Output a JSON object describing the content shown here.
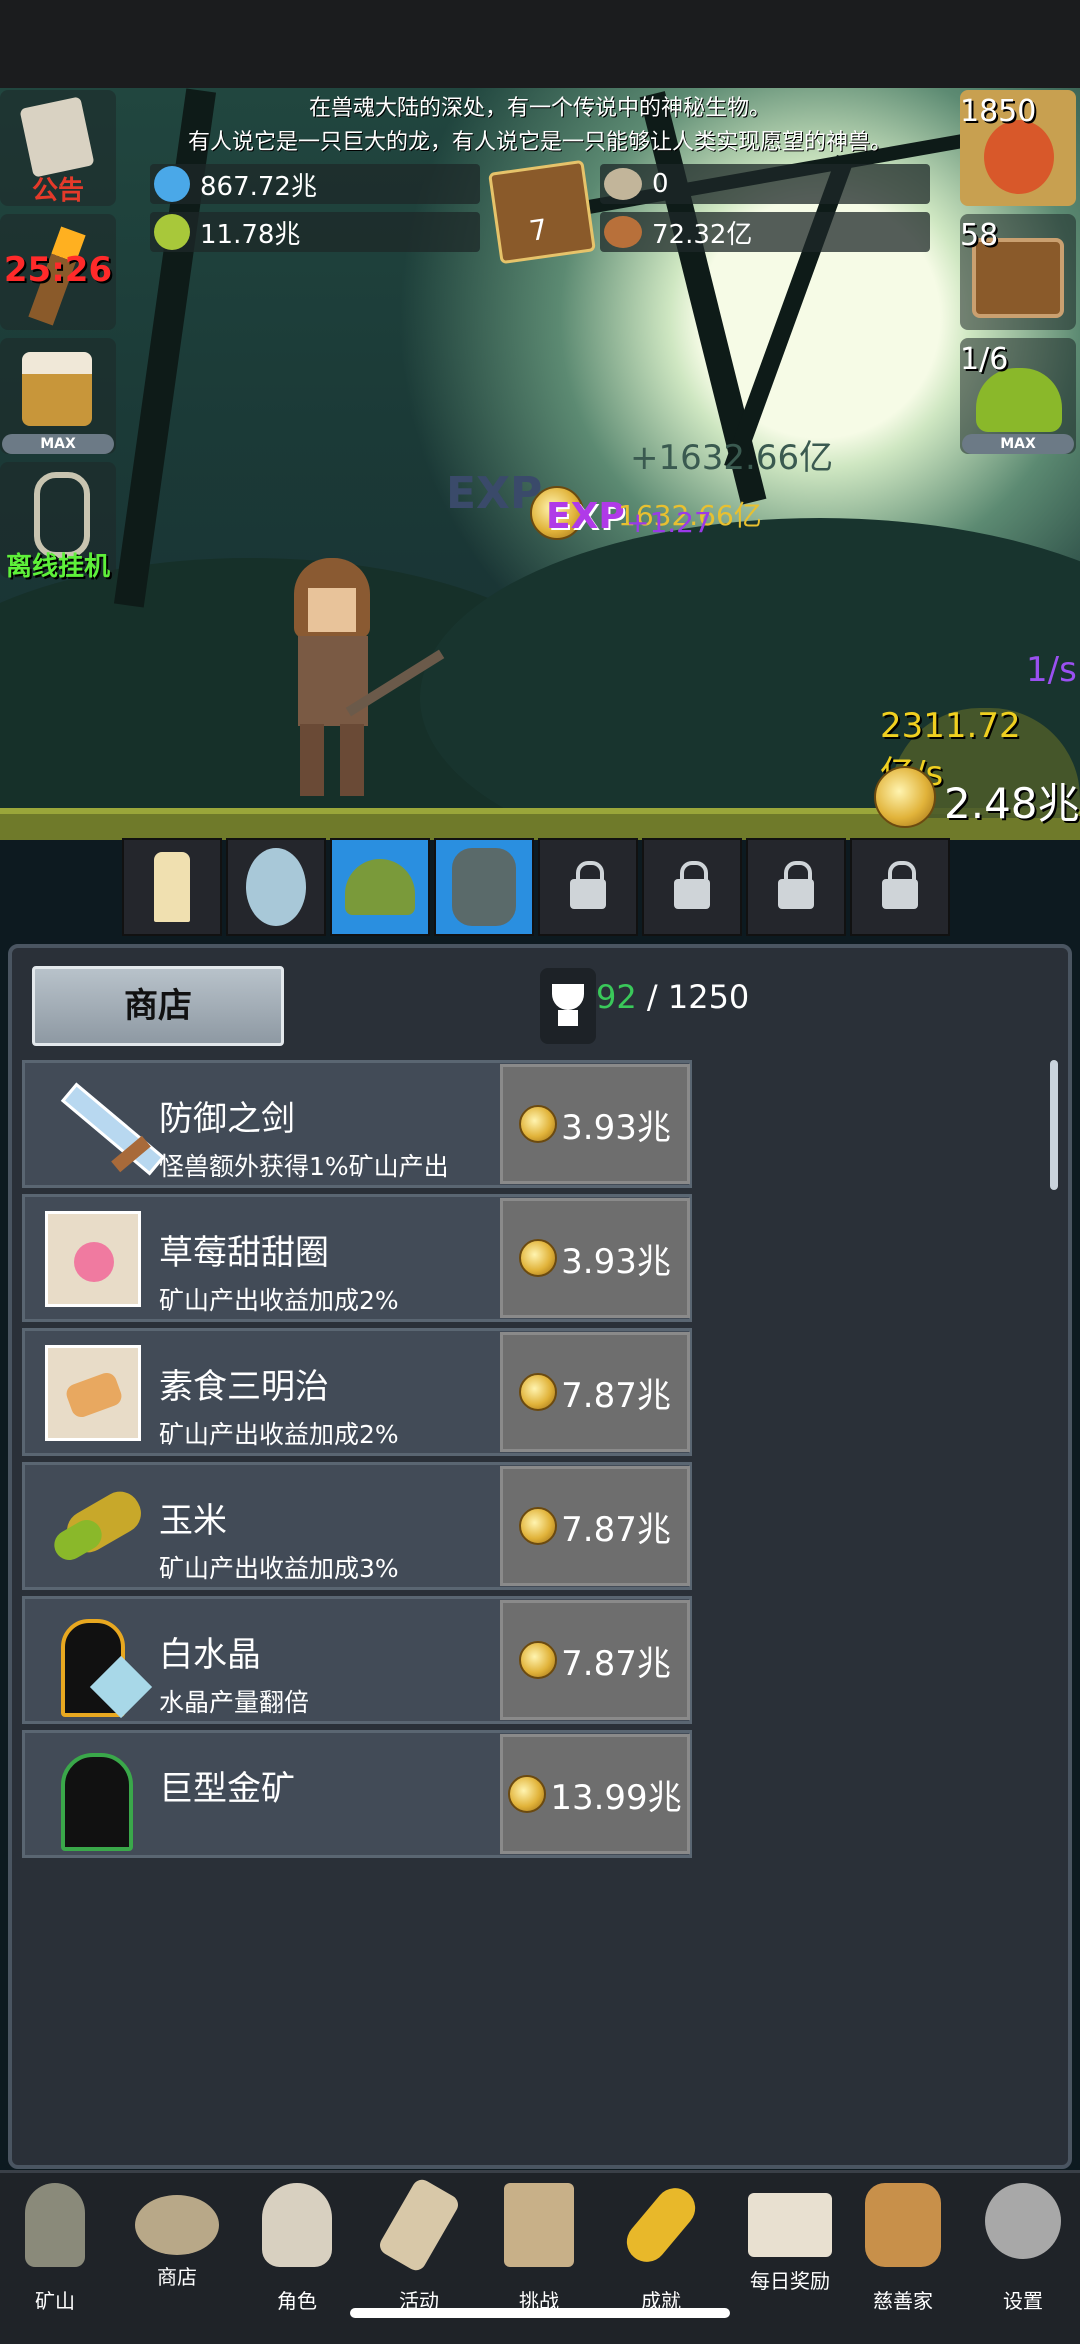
{
  "story": {
    "line1": "在兽魂大陆的深处，有一个传说中的神秘生物。",
    "line2": "有人说它是一只巨大的龙，有人说它是一只能够让人类实现愿望的神兽。"
  },
  "resources": {
    "blue_potion": "867.72兆",
    "green_potion": "11.78兆",
    "book_count": "7",
    "stone": "0",
    "meat": "72.32亿"
  },
  "left_buttons": {
    "notice_label": "公告",
    "timer_label": "25:26",
    "max_label": "MAX",
    "offline_label": "离线挂机"
  },
  "right_buttons": {
    "potion_count": "1850",
    "chest_count": "58",
    "slime_count": "1/6",
    "max_label": "MAX"
  },
  "floating": {
    "ghost_gain": "+1632.66亿",
    "exp_label": "EXP",
    "gain": "1632.66亿",
    "exp_gain": "+1.27",
    "exp_rate": "1/s",
    "coin_rate": "2311.72亿/s",
    "coin_total": "2.48兆"
  },
  "shop": {
    "tab_label": "商店",
    "trophy_current": "92",
    "trophy_sep": " / ",
    "trophy_total": "1250",
    "items": [
      {
        "name": "防御之剑",
        "desc": "怪兽额外获得1%矿山产出",
        "price": "3.93兆"
      },
      {
        "name": "草莓甜甜圈",
        "desc": "矿山产出收益加成2%",
        "price": "3.93兆"
      },
      {
        "name": "素食三明治",
        "desc": "矿山产出收益加成2%",
        "price": "7.87兆"
      },
      {
        "name": "玉米",
        "desc": "矿山产出收益加成3%",
        "price": "7.87兆"
      },
      {
        "name": "白水晶",
        "desc": "水晶产量翻倍",
        "price": "7.87兆"
      },
      {
        "name": "巨型金矿",
        "desc": "",
        "price": "13.99兆"
      }
    ]
  },
  "nav": [
    "矿山",
    "商店",
    "角色",
    "活动",
    "挑战",
    "成就",
    "每日奖励",
    "慈善家",
    "设置"
  ]
}
